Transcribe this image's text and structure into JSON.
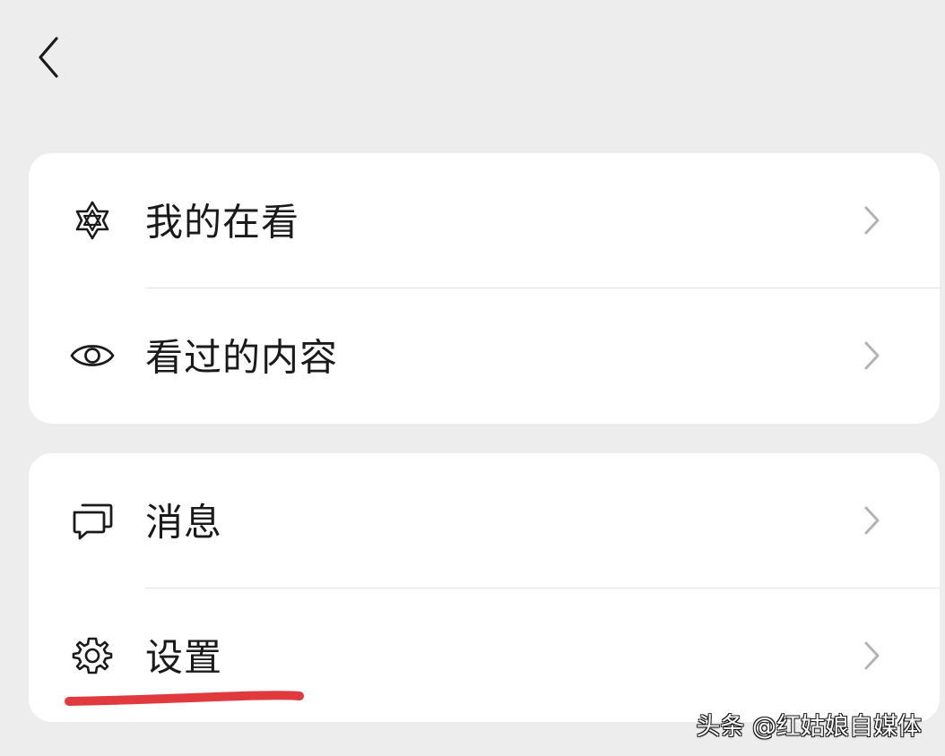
{
  "header": {
    "back_icon": "chevron-left-icon"
  },
  "groups": [
    {
      "items": [
        {
          "label": "我的在看",
          "icon": "hexagon-star-icon"
        },
        {
          "label": "看过的内容",
          "icon": "eye-icon"
        }
      ]
    },
    {
      "items": [
        {
          "label": "消息",
          "icon": "chat-bubbles-icon"
        },
        {
          "label": "设置",
          "icon": "gear-icon"
        }
      ]
    }
  ],
  "annotation": {
    "underline_color": "#E03A3E",
    "target": "设置"
  },
  "watermark": "头条 @红姑娘自媒体",
  "colors": {
    "background": "#EDEDED",
    "card": "#FFFFFF",
    "text": "#1A1A1A",
    "chevron": "#B3B3B3",
    "divider": "#E3E3E3"
  }
}
